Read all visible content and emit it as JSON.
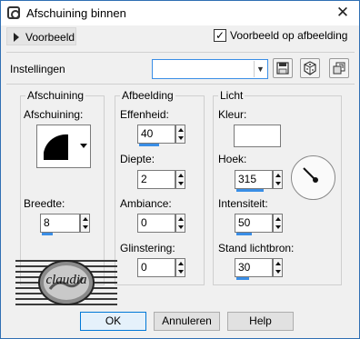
{
  "window": {
    "title": "Afschuining binnen",
    "close_glyph": "✕"
  },
  "preview": {
    "toggle_label": "Voorbeeld",
    "checkbox_label": "Voorbeeld op afbeelding",
    "checked": true,
    "check_glyph": "✓"
  },
  "settings": {
    "label": "Instellingen",
    "preset_value": ""
  },
  "toolbar": {
    "icons": [
      "save-preset-icon",
      "randomize-dice-icon",
      "reset-icon"
    ]
  },
  "bevel": {
    "title": "Afschuining",
    "shape_label": "Afschuining:",
    "width_label": "Breedte:",
    "width_value": "8"
  },
  "image": {
    "title": "Afbeelding",
    "smoothness_label": "Effenheid:",
    "smoothness_value": "40",
    "depth_label": "Diepte:",
    "depth_value": "2",
    "ambience_label": "Ambiance:",
    "ambience_value": "0",
    "shininess_label": "Glinstering:",
    "shininess_value": "0"
  },
  "light": {
    "title": "Licht",
    "color_label": "Kleur:",
    "color_value": "#ffffff",
    "angle_label": "Hoek:",
    "angle_value": "315",
    "intensity_label": "Intensiteit:",
    "intensity_value": "50",
    "elevation_label": "Stand lichtbron:",
    "elevation_value": "30"
  },
  "logo": {
    "text": "claudia"
  },
  "buttons": {
    "ok": "OK",
    "cancel": "Annuleren",
    "help": "Help"
  },
  "colors": {
    "accent": "#3a8ee6",
    "window_border": "#2f6fb3",
    "face": "#f0f0f0"
  }
}
